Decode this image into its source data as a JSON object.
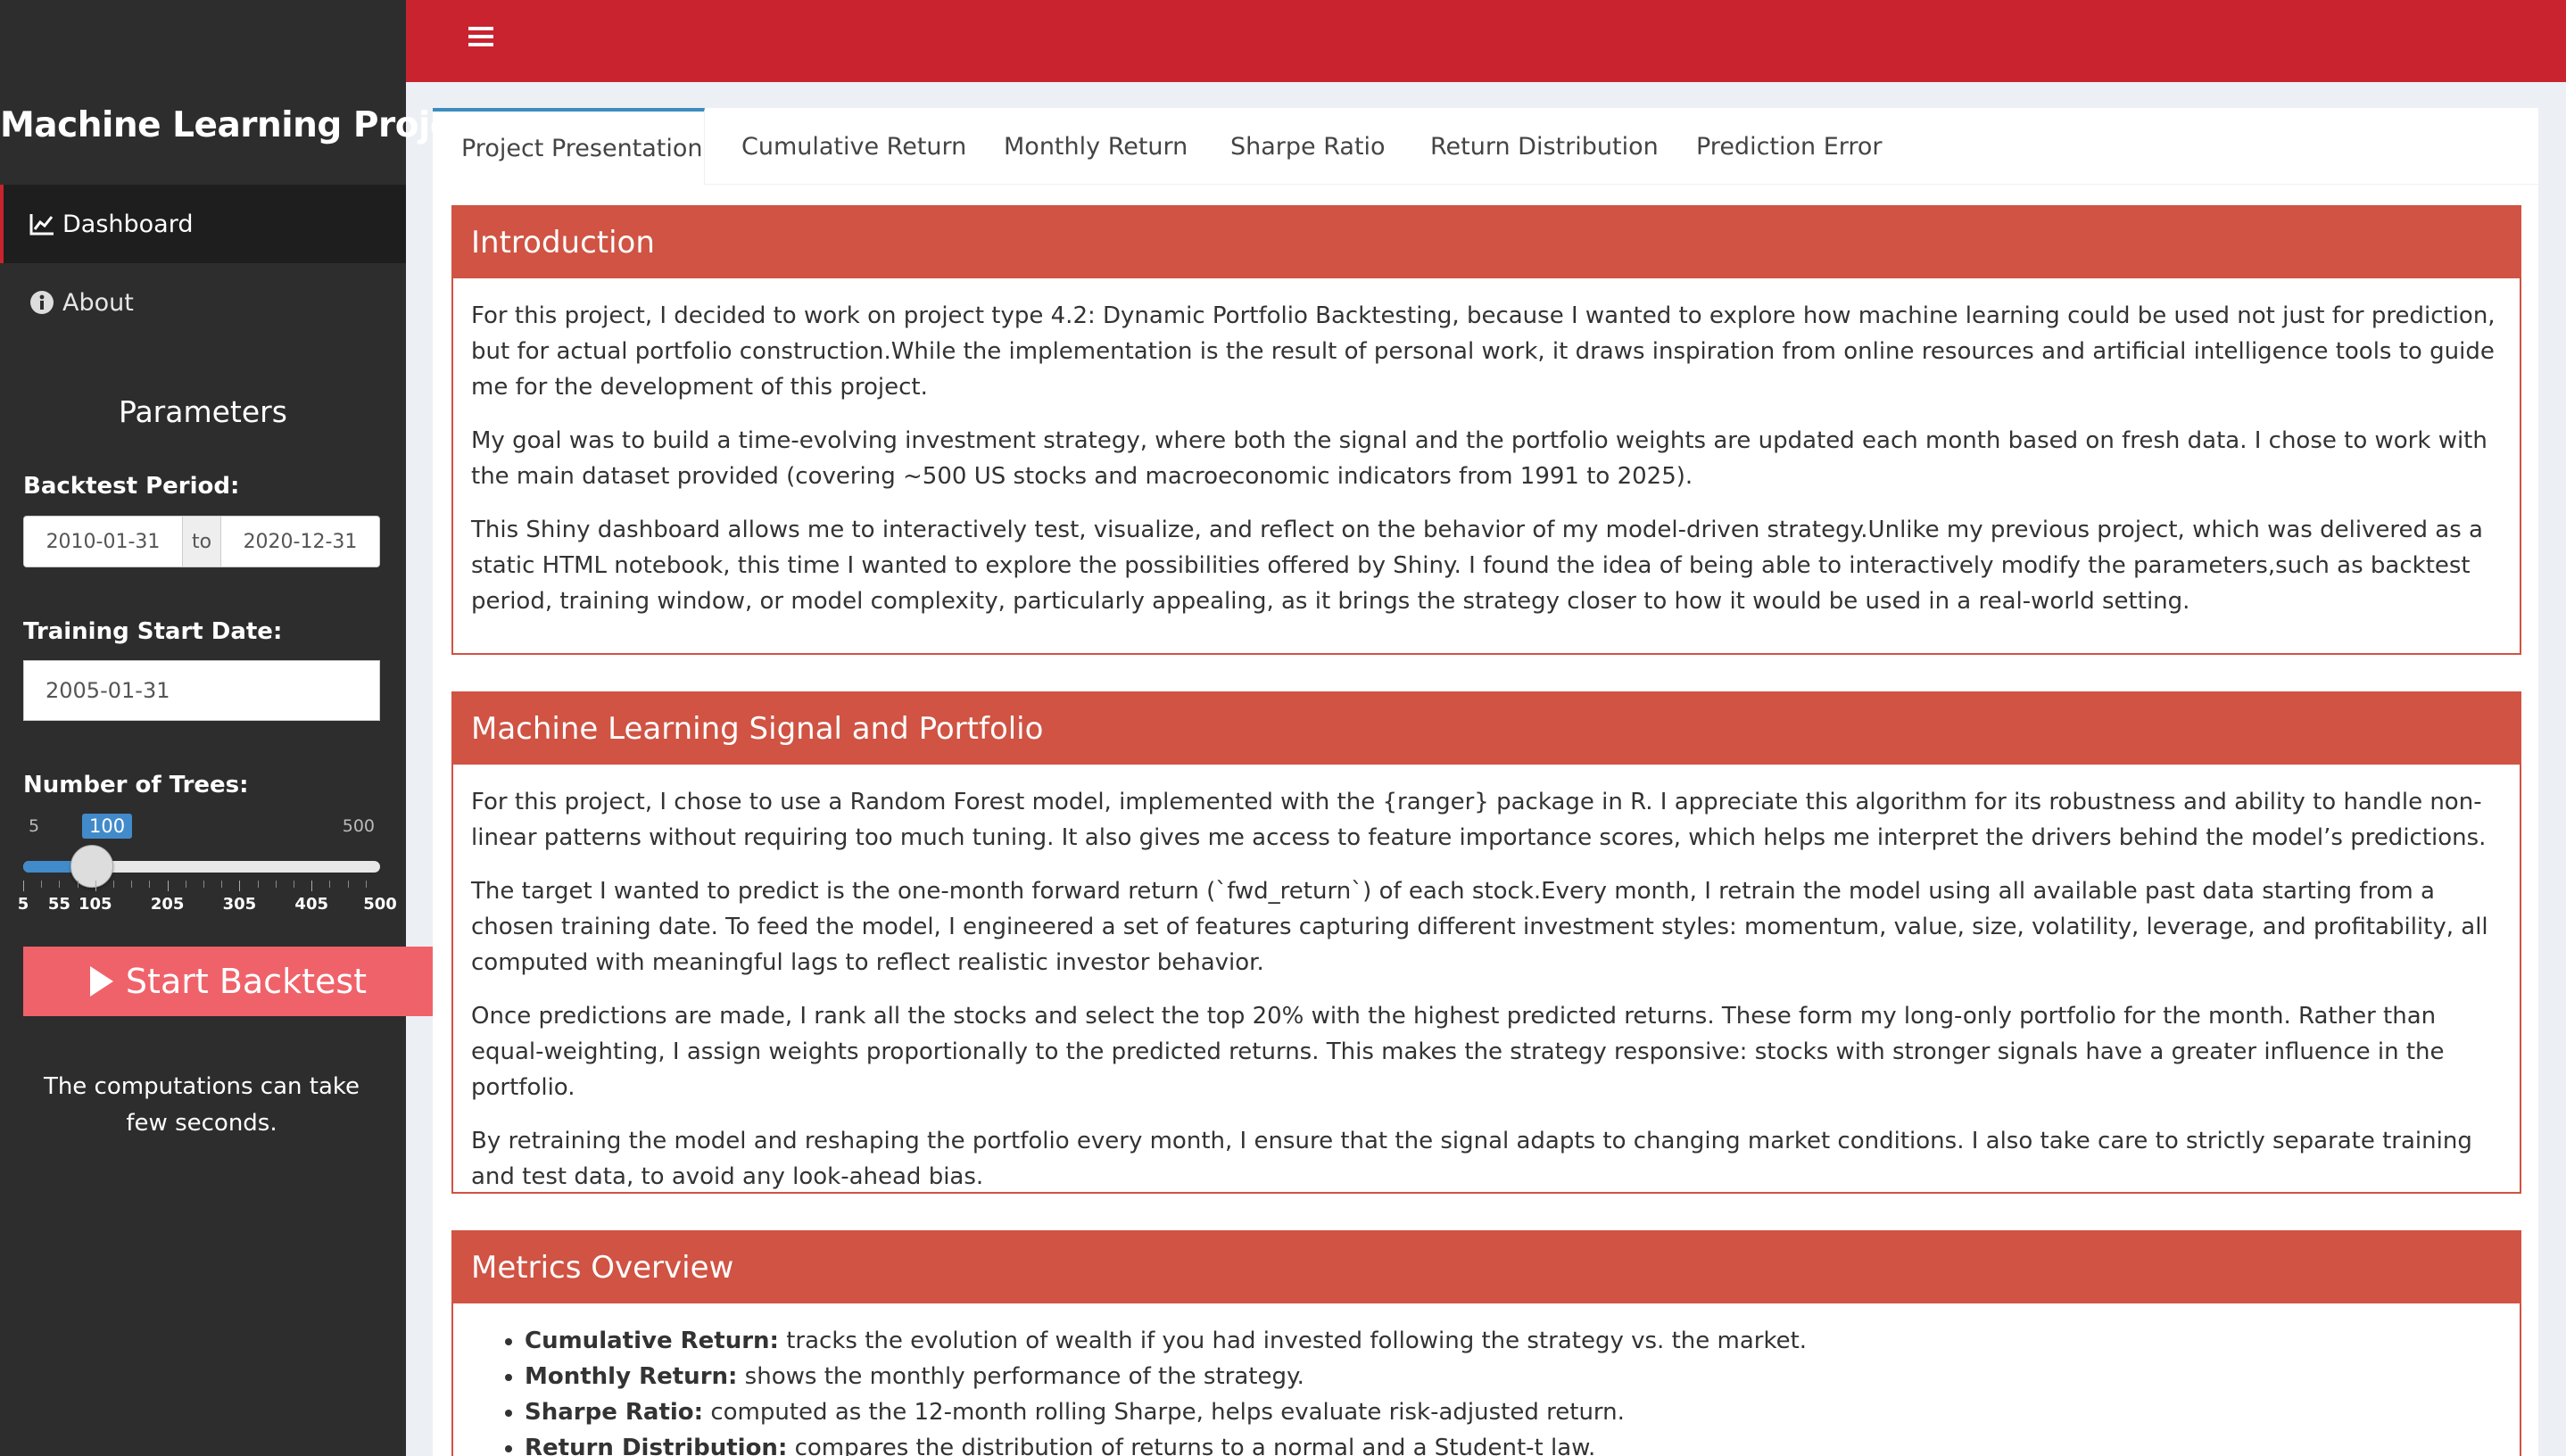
{
  "sidebar": {
    "brand": "Machine Learning Project",
    "menu": [
      {
        "label": "Dashboard",
        "icon": "line-chart-icon"
      },
      {
        "label": "About",
        "icon": "info-circle-icon"
      }
    ],
    "parameters_title": "Parameters",
    "backtest_period": {
      "label": "Backtest Period:",
      "start": "2010-01-31",
      "separator": "to",
      "end": "2020-12-31"
    },
    "training_start": {
      "label": "Training Start Date:",
      "value": "2005-01-31"
    },
    "trees": {
      "label": "Number of Trees:",
      "min": "5",
      "max": "500",
      "value": "100",
      "ticks": [
        "5",
        "55",
        "105",
        "205",
        "305",
        "405",
        "500"
      ]
    },
    "start_button": "Start Backtest",
    "note": "The computations can take few seconds."
  },
  "header": {
    "menu_icon": "hamburger-icon",
    "color": "#c8232f"
  },
  "tabs": [
    "Project Presentation",
    "Cumulative Return",
    "Monthly Return",
    "Sharpe Ratio",
    "Return Distribution",
    "Prediction Error"
  ],
  "sections": {
    "intro": {
      "title": "Introduction",
      "p1": "For this project, I decided to work on project type 4.2: Dynamic Portfolio Backtesting, because I wanted to explore how machine learning could be used not just for prediction, but for actual portfolio construction.While the implementation is the result of personal work, it draws inspiration from online resources and artificial intelligence tools to guide me for the development of this project.",
      "p2": "My goal was to build a time-evolving investment strategy, where both the signal and the portfolio weights are updated each month based on fresh data. I chose to work with the main dataset provided (covering ~500 US stocks and macroeconomic indicators from 1991 to 2025).",
      "p3": "This Shiny dashboard allows me to interactively test, visualize, and reflect on the behavior of my model-driven strategy.Unlike my previous project, which was delivered as a static HTML notebook, this time I wanted to explore the possibilities offered by Shiny. I found the idea of being able to interactively modify the parameters,such as backtest period, training window, or model complexity, particularly appealing, as it brings the strategy closer to how it would be used in a real-world setting."
    },
    "ml": {
      "title": "Machine Learning Signal and Portfolio",
      "p1": "For this project, I chose to use a Random Forest model, implemented with the {ranger} package in R. I appreciate this algorithm for its robustness and ability to handle non-linear patterns without requiring too much tuning. It also gives me access to feature importance scores, which helps me interpret the drivers behind the model’s predictions.",
      "p2": "The target I wanted to predict is the one-month forward return (`fwd_return`) of each stock.Every month, I retrain the model using all available past data starting from a chosen training date. To feed the model, I engineered a set of features capturing different investment styles: momentum, value, size, volatility, leverage, and profitability, all computed with meaningful lags to reflect realistic investor behavior.",
      "p3": "Once predictions are made, I rank all the stocks and select the top 20% with the highest predicted returns. These form my long-only portfolio for the month. Rather than equal-weighting, I assign weights proportionally to the predicted returns. This makes the strategy responsive: stocks with stronger signals have a greater influence in the portfolio.",
      "p4": "By retraining the model and reshaping the portfolio every month, I ensure that the signal adapts to changing market conditions. I also take care to strictly separate training and test data, to avoid any look-ahead bias."
    },
    "metrics": {
      "title": "Metrics Overview",
      "items": [
        {
          "term": "Cumulative Return:",
          "desc": " tracks the evolution of wealth if you had invested following the strategy vs. the market."
        },
        {
          "term": "Monthly Return:",
          "desc": " shows the monthly performance of the strategy."
        },
        {
          "term": "Sharpe Ratio:",
          "desc": " computed as the 12-month rolling Sharpe, helps evaluate risk-adjusted return."
        },
        {
          "term": "Return Distribution:",
          "desc": " compares the distribution of returns to a normal and a Student-t law."
        }
      ]
    }
  }
}
